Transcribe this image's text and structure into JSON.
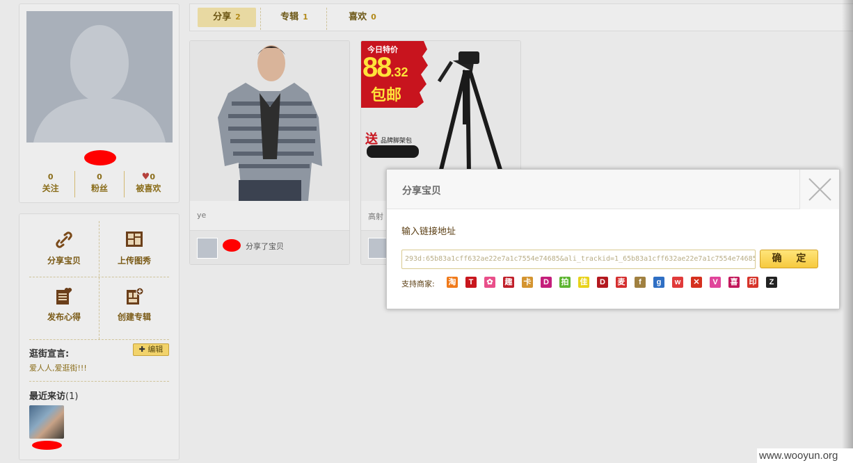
{
  "profile": {
    "stats": [
      {
        "count": "0",
        "label": "关注"
      },
      {
        "count": "0",
        "label": "粉丝"
      },
      {
        "count": "0",
        "label": "被喜欢"
      }
    ]
  },
  "actions": {
    "share": "分享宝贝",
    "upload": "上传图秀",
    "publish": "发布心得",
    "create_album": "创建专辑"
  },
  "slogan": {
    "title": "逛街宣言:",
    "edit": "编辑",
    "text": "爱人人,爱逛街!!!"
  },
  "visitors": {
    "title": "最近来访",
    "count": "(1)"
  },
  "tabs": [
    {
      "label": "分享",
      "count": "2"
    },
    {
      "label": "专辑",
      "count": "1"
    },
    {
      "label": "喜欢",
      "count": "0"
    }
  ],
  "cards": [
    {
      "desc": "ye",
      "action": "分享了宝贝"
    },
    {
      "desc": "高射",
      "promo_top": "今日特价",
      "promo_price": "88",
      "promo_cents": ".32",
      "promo_free": "包邮",
      "promo_gift_big": "送",
      "promo_gift": "品牌脚架包"
    }
  ],
  "modal": {
    "title": "分享宝贝",
    "label": "输入链接地址",
    "url_value": "293d:65b83a1cff632ae22e7a1c7554e74685&ali_trackid=1_65b83a1cff632ae22e7a1c7554e74685",
    "ok": "确 定",
    "merchants_label": "支持商家:"
  },
  "merchants": [
    {
      "glyph": "淘",
      "color": "#f07a1a"
    },
    {
      "glyph": "T",
      "color": "#c8161d"
    },
    {
      "glyph": "✿",
      "color": "#e94f8a"
    },
    {
      "glyph": "趣",
      "color": "#c01f2a"
    },
    {
      "glyph": "卡",
      "color": "#d49430"
    },
    {
      "glyph": "D",
      "color": "#c41e7b"
    },
    {
      "glyph": "拍",
      "color": "#5cb531"
    },
    {
      "glyph": "佳",
      "color": "#e8d21a"
    },
    {
      "glyph": "D",
      "color": "#b3181f"
    },
    {
      "glyph": "麦",
      "color": "#d42e2e"
    },
    {
      "glyph": "f",
      "color": "#a08040"
    },
    {
      "glyph": "g",
      "color": "#2f6fc4"
    },
    {
      "glyph": "w",
      "color": "#e03a3a"
    },
    {
      "glyph": "✕",
      "color": "#d5301e"
    },
    {
      "glyph": "V",
      "color": "#e0449a"
    },
    {
      "glyph": "喜",
      "color": "#c2185b"
    },
    {
      "glyph": "印",
      "color": "#d6342a"
    },
    {
      "glyph": "Z",
      "color": "#222222"
    }
  ],
  "watermark": "www.wooyun.org"
}
